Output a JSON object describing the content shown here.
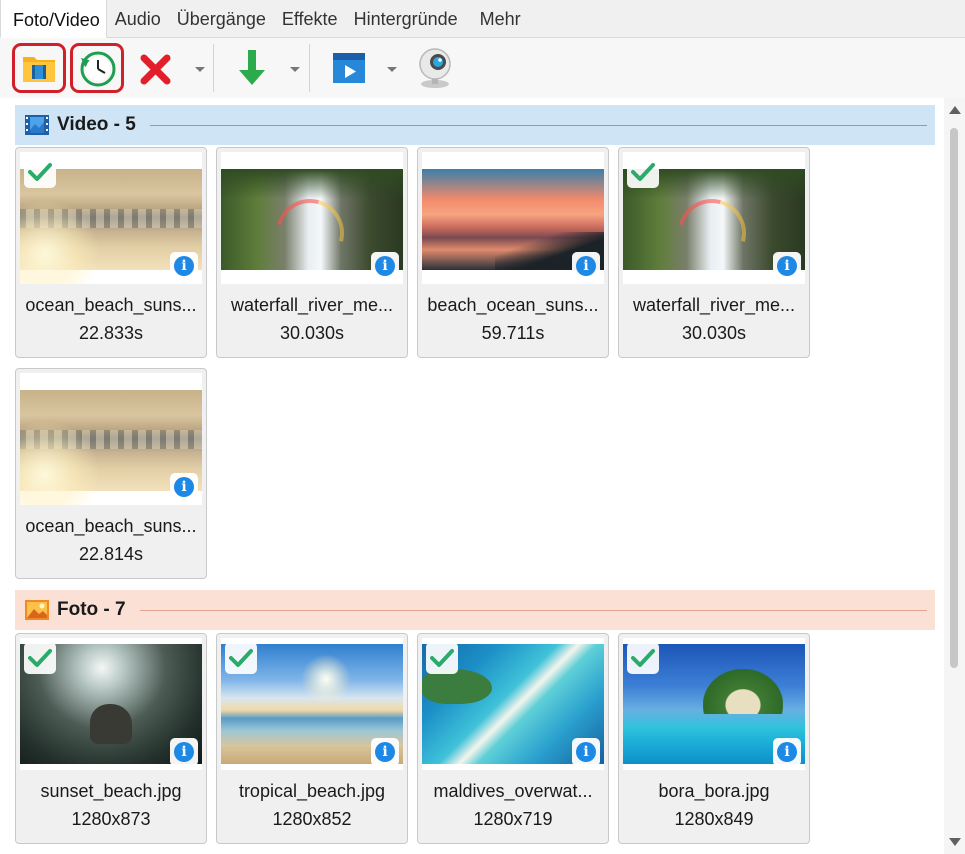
{
  "tabs": [
    {
      "label": "Foto/Video",
      "active": true
    },
    {
      "label": "Audio",
      "active": false
    },
    {
      "label": "Übergänge",
      "active": false
    },
    {
      "label": "Effekte",
      "active": false
    },
    {
      "label": "Hintergründe",
      "active": false
    },
    {
      "label": "Mehr",
      "active": false
    }
  ],
  "toolbar": {
    "icons": [
      "add-media-folder-icon",
      "recent-history-icon",
      "delete-icon",
      "import-download-icon",
      "video-playlist-icon",
      "webcam-icon"
    ],
    "highlight_color": "#d0212b"
  },
  "sections": {
    "video": {
      "title": "Video - 5",
      "icon": "video-film-icon",
      "color": "#cfe4f5",
      "items": [
        {
          "name": "ocean_beach_suns...",
          "meta": "22.833s",
          "checked": true,
          "art": "img-ocean"
        },
        {
          "name": "waterfall_river_me...",
          "meta": "30.030s",
          "checked": false,
          "art": "img-waterfall"
        },
        {
          "name": "beach_ocean_suns...",
          "meta": "59.711s",
          "checked": false,
          "art": "img-sunset"
        },
        {
          "name": "waterfall_river_me...",
          "meta": "30.030s",
          "checked": true,
          "art": "img-waterfall"
        },
        {
          "name": "ocean_beach_suns...",
          "meta": "22.814s",
          "checked": false,
          "art": "img-ocean"
        }
      ]
    },
    "photo": {
      "title": "Foto - 7",
      "icon": "photo-picture-icon",
      "color": "#fbe0d6",
      "items": [
        {
          "name": "sunset_beach.jpg",
          "meta": "1280x873",
          "checked": true,
          "art": "img-elephant"
        },
        {
          "name": "tropical_beach.jpg",
          "meta": "1280x852",
          "checked": true,
          "art": "img-tropical"
        },
        {
          "name": "maldives_overwat...",
          "meta": "1280x719",
          "checked": true,
          "art": "img-maldives"
        },
        {
          "name": "bora_bora.jpg",
          "meta": "1280x849",
          "checked": true,
          "art": "img-bora"
        }
      ]
    }
  },
  "colors": {
    "check_green": "#2bab6b",
    "info_blue": "#1e88e5",
    "card_bg": "#f0f0f0"
  }
}
